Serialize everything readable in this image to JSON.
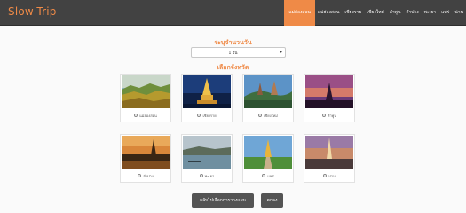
{
  "brand": "Slow-Trip",
  "nav": {
    "items": [
      "แม่ฮ่องสอน",
      "แม่ฮ่องสอน",
      "เชียงราย",
      "เชียงใหม่",
      "ลำพูน",
      "ลำปาง",
      "พะเยา",
      "แพร่",
      "น่าน"
    ],
    "active_index": 0
  },
  "form": {
    "days_heading": "ระบุจำนวนวัน",
    "days_value": "1 วัน",
    "province_heading": "เลือกจังหวัด"
  },
  "provinces": [
    {
      "name": "แม่ฮ่องสอน",
      "image": "mountain-landscape"
    },
    {
      "name": "เชียงราย",
      "image": "golden-pagoda-night"
    },
    {
      "name": "เชียงใหม่",
      "image": "twin-pagodas-hill"
    },
    {
      "name": "ลำพูน",
      "image": "temple-purple-sunset"
    },
    {
      "name": "ลำปาง",
      "image": "temple-sunset-water"
    },
    {
      "name": "พะเยา",
      "image": "lake-view"
    },
    {
      "name": "แพร่",
      "image": "golden-pagoda-garden"
    },
    {
      "name": "น่าน",
      "image": "temple-spire-dusk"
    }
  ],
  "buttons": {
    "back": "กลับไปเลือกการวางแผน",
    "ok": "ตกลง"
  },
  "colors": {
    "accent": "#ef8a47",
    "topbar": "#424242",
    "button": "#545454"
  }
}
